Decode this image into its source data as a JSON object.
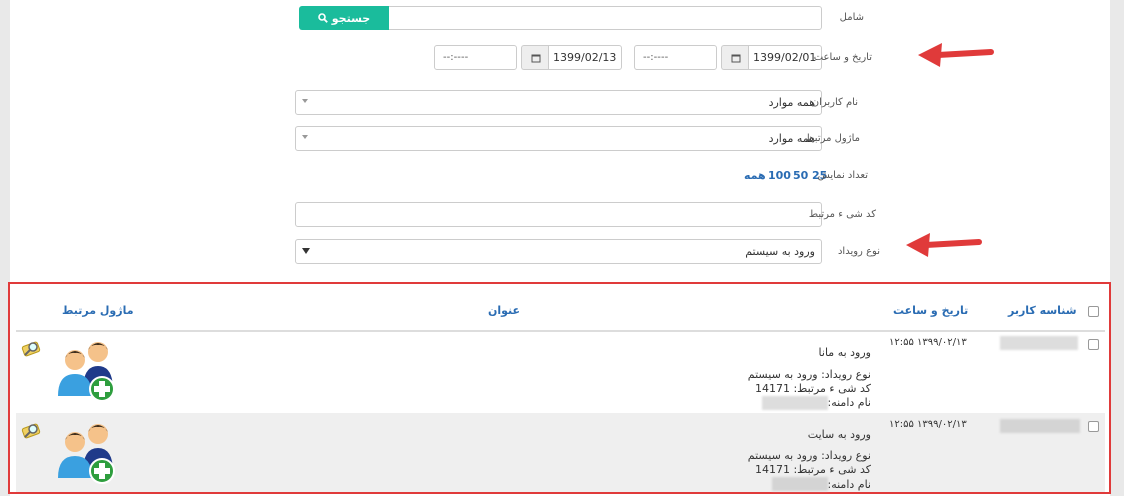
{
  "filters": {
    "includes_label": "شامل",
    "search_button": "جستجو",
    "datetime_label": "تاریخ و ساعت",
    "date_from": "1399/02/01",
    "date_to": "1399/02/13",
    "time_placeholder": "--:--",
    "time_marker": "--",
    "users_label": "نام کاربران",
    "users_value": "همه موارد",
    "module_label": "ماژول مرتبط",
    "module_value": "همه موارد",
    "display_count_label": "تعداد نمایش",
    "display_counts": [
      "25",
      "50",
      "100",
      "همه"
    ],
    "object_code_label": "کد شی ء مرتبط",
    "event_type_label": "نوع رویداد",
    "event_type_value": "ورود به سیستم"
  },
  "table": {
    "headers": {
      "user_id": "شناسه کاربر",
      "datetime": "تاریخ و ساعت",
      "title": "عنوان",
      "module": "ماژول مرتبط"
    },
    "rows": [
      {
        "datetime": "۱۳۹۹/۰۲/۱۳ ۱۲:۵۵",
        "title": "ورود به مانا",
        "event_line": "نوع رویداد: ورود به سیستم",
        "object_line": "کد شی ء مرتبط: 14171",
        "domain_line": "نام دامنه:"
      },
      {
        "datetime": "۱۳۹۹/۰۲/۱۳ ۱۲:۵۵",
        "title": "ورود به سایت",
        "event_line": "نوع رویداد: ورود به سیستم",
        "object_line": "کد شی ء مرتبط: 14171",
        "domain_line": "نام دامنه:"
      }
    ]
  },
  "colors": {
    "accent": "#1abc9c",
    "link": "#2a6cb3",
    "annotation": "#e03a3a"
  },
  "icons": [
    "search-icon",
    "calendar-icon",
    "users-add-icon",
    "magnifier-note-icon",
    "annotation-arrow-icon"
  ]
}
